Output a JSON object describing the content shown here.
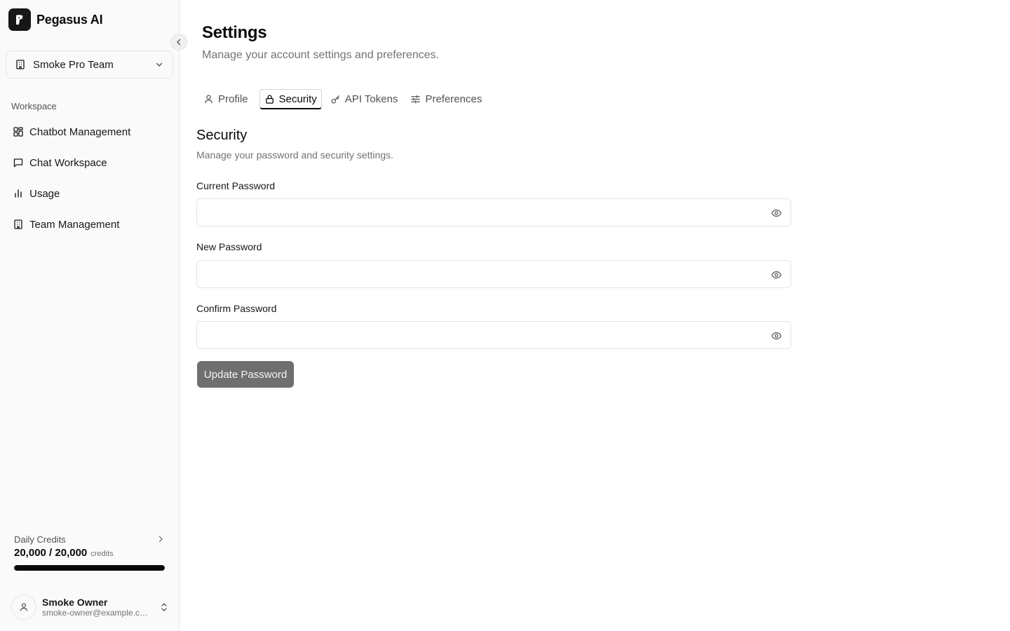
{
  "app": {
    "name": "Pegasus AI"
  },
  "team": {
    "name": "Smoke Pro Team"
  },
  "sidebar": {
    "section_label": "Workspace",
    "items": [
      {
        "label": "Chatbot Management",
        "icon": "grid-icon"
      },
      {
        "label": "Chat Workspace",
        "icon": "message-square-icon"
      },
      {
        "label": "Usage",
        "icon": "bar-chart-icon"
      },
      {
        "label": "Team Management",
        "icon": "building-icon"
      }
    ]
  },
  "credits": {
    "title": "Daily Credits",
    "value": "20,000 / 20,000",
    "unit": "credits",
    "fraction": 1.0
  },
  "user": {
    "name": "Smoke Owner",
    "email": "smoke-owner@example.com"
  },
  "page": {
    "title": "Settings",
    "subtitle": "Manage your account settings and preferences."
  },
  "tabs": [
    {
      "label": "Profile",
      "icon": "user-icon",
      "active": false
    },
    {
      "label": "Security",
      "icon": "lock-icon",
      "active": true
    },
    {
      "label": "API Tokens",
      "icon": "key-icon",
      "active": false
    },
    {
      "label": "Preferences",
      "icon": "sliders-icon",
      "active": false
    }
  ],
  "security": {
    "title": "Security",
    "description": "Manage your password and security settings.",
    "fields": [
      {
        "label": "Current Password",
        "value": "",
        "placeholder": ""
      },
      {
        "label": "New Password",
        "value": "",
        "placeholder": ""
      },
      {
        "label": "Confirm Password",
        "value": "",
        "placeholder": ""
      }
    ],
    "submit_label": "Update Password"
  },
  "colors": {
    "sidebar_bg": "#fafafa",
    "primary": "#0a0a0a",
    "button_disabled": "#6f6f6f",
    "border": "#e5e5e5",
    "muted_text": "#737373"
  }
}
